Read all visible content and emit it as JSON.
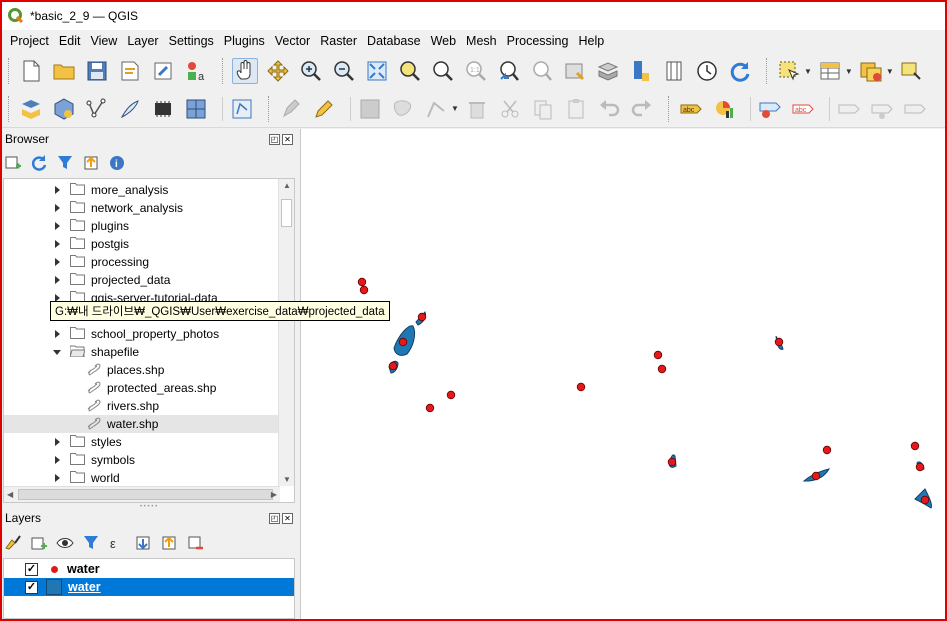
{
  "window": {
    "title": "*basic_2_9 — QGIS"
  },
  "menu": [
    "Project",
    "Edit",
    "View",
    "Layer",
    "Settings",
    "Plugins",
    "Vector",
    "Raster",
    "Database",
    "Web",
    "Mesh",
    "Processing",
    "Help"
  ],
  "toolbar1": [
    "new-project-icon",
    "open-project-icon",
    "save-project-icon",
    "print-layout-icon",
    "style-manager-icon",
    "python-console-icon",
    "pan-icon",
    "pan-to-selection-icon",
    "zoom-in-icon",
    "zoom-out-icon",
    "zoom-full-icon",
    "zoom-to-selection-icon",
    "zoom-to-layer-icon",
    "zoom-native-icon",
    "zoom-last-icon",
    "zoom-next-icon",
    "new-bookmark-icon",
    "show-bookmarks-icon",
    "new-map-view-icon",
    "new-3d-view-icon",
    "temporal-controller-icon",
    "refresh-icon",
    "select-feature-icon",
    "attribute-table-icon",
    "field-calculator-icon",
    "annotation-icon"
  ],
  "toolbar2": [
    "data-source-manager-icon",
    "new-geopackage-icon",
    "new-shapefile-icon",
    "new-spatialite-icon",
    "new-temporary-layer-icon",
    "new-virtual-layer-icon",
    "digitizing-icon",
    "toggle-editing-icon",
    "pencil-icon",
    "save-edits-icon",
    "add-feature-icon",
    "vertex-tool-icon",
    "delete-selected-icon",
    "cut-features-icon",
    "copy-features-icon",
    "paste-features-icon",
    "undo-icon",
    "redo-icon",
    "label-icon",
    "diagram-icon",
    "layer-labeling-icon",
    "highlight-pinned-label-icon",
    "pin-label-icon",
    "show-hide-label-icon",
    "move-label-icon",
    "rotate-label-icon"
  ],
  "browser": {
    "title": "Browser",
    "items": [
      {
        "label": "more_analysis",
        "type": "folder",
        "expanded": false
      },
      {
        "label": "network_analysis",
        "type": "folder",
        "expanded": false
      },
      {
        "label": "plugins",
        "type": "folder",
        "expanded": false
      },
      {
        "label": "postgis",
        "type": "folder",
        "expanded": false
      },
      {
        "label": "processing",
        "type": "folder",
        "expanded": false
      },
      {
        "label": "projected_data",
        "type": "folder",
        "expanded": false
      },
      {
        "label": "qgis-server-tutorial-data",
        "type": "folder",
        "expanded": false
      },
      {
        "label": "",
        "type": "folder",
        "expanded": false
      },
      {
        "label": "school_property_photos",
        "type": "folder",
        "expanded": false
      },
      {
        "label": "shapefile",
        "type": "folder",
        "expanded": true
      },
      {
        "label": "places.shp",
        "type": "shp"
      },
      {
        "label": "protected_areas.shp",
        "type": "shp"
      },
      {
        "label": "rivers.shp",
        "type": "shp"
      },
      {
        "label": "water.shp",
        "type": "shp",
        "selected": true
      },
      {
        "label": "styles",
        "type": "folder",
        "expanded": false
      },
      {
        "label": "symbols",
        "type": "folder",
        "expanded": false
      },
      {
        "label": "world",
        "type": "folder",
        "expanded": false
      }
    ],
    "tooltip": "G:₩내 드라이브₩_QGIS₩User₩exercise_data₩projected_data"
  },
  "layers": {
    "title": "Layers",
    "items": [
      {
        "label": "water",
        "checked": true,
        "symbol": "point",
        "selected": false
      },
      {
        "label": "water",
        "checked": true,
        "symbol": "polygon",
        "selected": true
      }
    ]
  },
  "colors": {
    "point_fill": "#e31a1c",
    "polygon_fill": "#1f78b4",
    "selection": "#0078d7",
    "window_border": "#e00000"
  }
}
